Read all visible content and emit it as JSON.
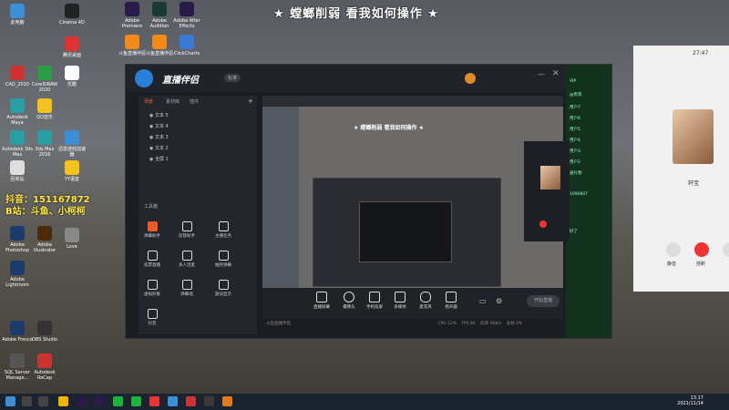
{
  "banner": "★ 螳螂削弱 看我如何操作 ★",
  "desktop": {
    "icons": [
      "此电脑",
      "Cinema 4D",
      "Adobe Premiere",
      "Adobe Audition",
      "Adobe After Effects",
      "斗鱼直播伴侣",
      "斗鱼直播伴侣",
      "ClickCharts",
      "腾讯桌面",
      "CAD_2010",
      "CorelDRAW 2020",
      "优酷",
      "Autodesk Maya",
      "QQ音乐",
      "Autodesk 3ds Max",
      "3ds Max 2016",
      "迅雷游戏加速器",
      "回收站",
      "YY语音",
      "Adobe Photoshop",
      "Adobe Illustrator",
      "Adobe Lightroom",
      "Love",
      "OBS Studio",
      "Adobe Fresco",
      "SQL Server Manage...",
      "Autodesk ReCap"
    ],
    "douyin_line1": "抖音：151167872",
    "douyin_line2": "B站：斗鱼、小柯柯"
  },
  "app": {
    "title": "直播伴侣",
    "badge": "标准",
    "tabs": [
      "场景",
      "素材库",
      "插件"
    ],
    "scenes": [
      "文本 5",
      "文本 4",
      "文本 3",
      "文本 2",
      "全屏 1"
    ],
    "toolbox_title": "工具箱",
    "tools": [
      "弹幕助手",
      "房管助手",
      "主播任务",
      "投票直播",
      "多人连麦",
      "抽奖弹幕",
      "虚拟形象",
      "弹幕墙",
      "歌词显示",
      "抖音"
    ],
    "controls": [
      "直播屏幕",
      "摄像头",
      "手机投屏",
      "多媒体",
      "麦克风",
      "扬声器"
    ],
    "start_live": "开始直播",
    "status": "斗鱼直播伴侣",
    "status_stats": [
      "CPU 12%",
      "FPS 60",
      "码率 0Kb/s",
      "丢帧 0%"
    ],
    "preview_banner": "★ 螳螂削弱 看我如何操作 ★"
  },
  "chat": {
    "lines": [
      "VIP",
      "@贵宾",
      "用户7",
      "用户6",
      "用户5",
      "用户4",
      "用户3",
      "用户2",
      "送礼物",
      "1090807",
      "好了"
    ]
  },
  "call": {
    "time": "27:47",
    "name": "轩宝",
    "mute": "静音",
    "hangup": "挂断",
    "speaker": "扬声器"
  },
  "taskbar": {
    "time": "13:17",
    "date": "2021/11/14"
  }
}
